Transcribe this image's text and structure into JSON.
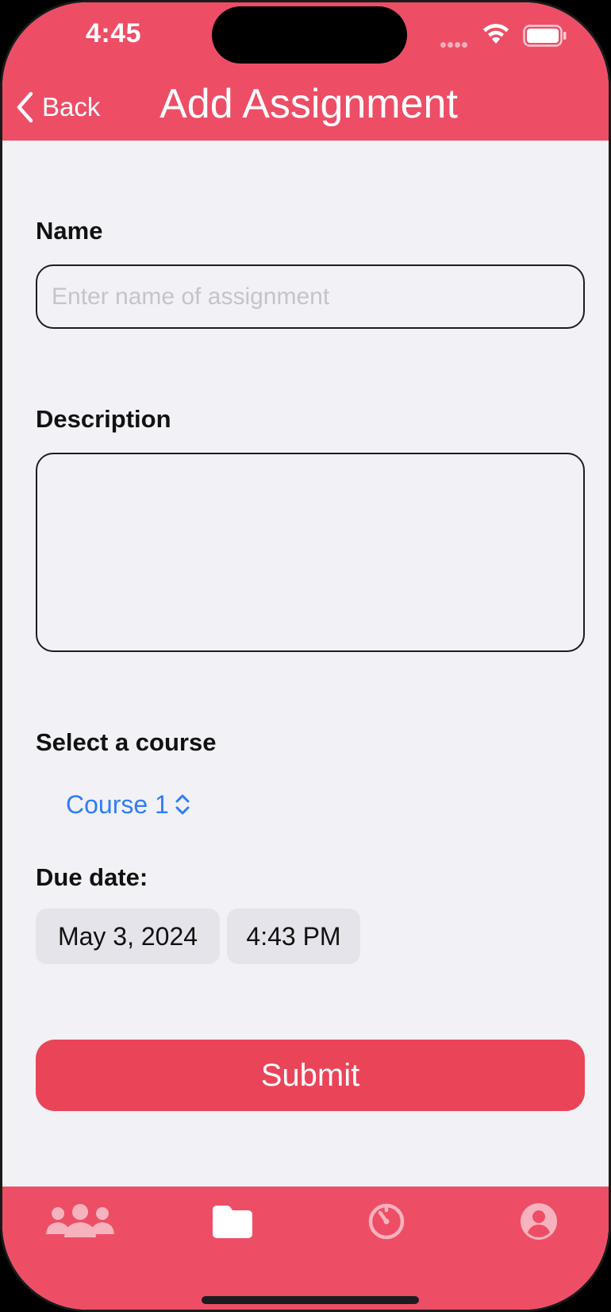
{
  "status_bar": {
    "time": "4:45"
  },
  "nav": {
    "back_label": "Back",
    "title": "Add Assignment"
  },
  "form": {
    "name_label": "Name",
    "name_placeholder": "Enter name of assignment",
    "name_value": "",
    "description_label": "Description",
    "description_value": "",
    "course_label": "Select a course",
    "course_value": "Course 1",
    "due_label": "Due date:",
    "due_date": "May 3, 2024",
    "due_time": "4:43 PM",
    "submit_label": "Submit"
  },
  "tabs": [
    {
      "icon": "people-icon",
      "active": false
    },
    {
      "icon": "folder-icon",
      "active": true
    },
    {
      "icon": "timer-icon",
      "active": false
    },
    {
      "icon": "profile-icon",
      "active": false
    }
  ],
  "colors": {
    "accent": "#ED4E66",
    "submit": "#EA4459",
    "link_blue": "#2F7DF6",
    "background": "#F2F1F6",
    "pill": "#E4E4EA"
  }
}
